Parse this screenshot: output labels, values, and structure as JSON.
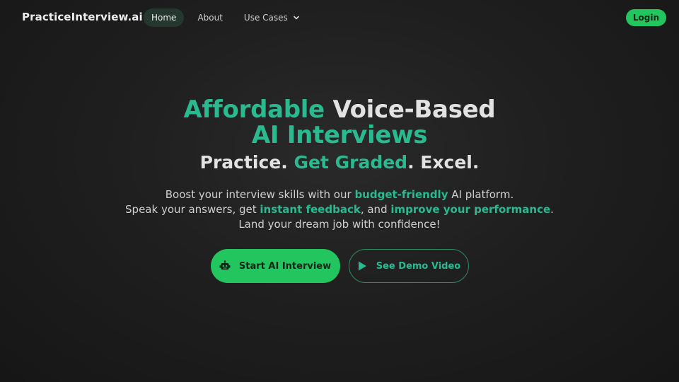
{
  "nav": {
    "brand": "PracticeInterview.ai",
    "links": [
      {
        "label": "Home"
      },
      {
        "label": "About"
      },
      {
        "label": "Use Cases"
      }
    ],
    "login": "Login"
  },
  "hero": {
    "title_part1": "Affordable",
    "title_part2": " Voice-Based",
    "title_line2": "AI Interviews",
    "sub_1": "Practice. ",
    "sub_2": "Get Graded",
    "sub_3": ". Excel.",
    "desc_1a": "Boost your interview skills with our ",
    "desc_1b": "budget-friendly",
    "desc_1c": " AI platform.",
    "desc_2a": "Speak your answers, get ",
    "desc_2b": "instant feedback",
    "desc_2c": ", and ",
    "desc_2d": "improve your performance",
    "desc_2e": ".",
    "desc_3": "Land your dream job with confidence!"
  },
  "cta": {
    "primary_label": "Start AI Interview",
    "primary_icon": "robot-icon",
    "secondary_label": "See Demo Video",
    "secondary_icon": "play-icon"
  },
  "colors": {
    "accent": "#22c55e",
    "accent_text": "#2bb98f",
    "background": "#1f1f1f"
  }
}
